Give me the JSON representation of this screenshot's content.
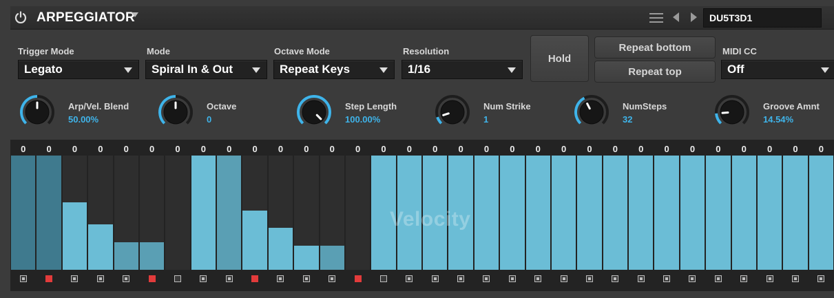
{
  "header": {
    "title": "ARPEGGIATOR",
    "preset_name": "DU5T3D1",
    "icons": [
      "power-icon",
      "hamburger-menu-icon",
      "prev-arrow-icon",
      "next-arrow-icon",
      "chevron-down-icon"
    ]
  },
  "controls": {
    "trigger_mode": {
      "label": "Trigger Mode",
      "value": "Legato"
    },
    "mode": {
      "label": "Mode",
      "value": "Spiral In & Out"
    },
    "octave_mode": {
      "label": "Octave Mode",
      "value": "Repeat Keys"
    },
    "resolution": {
      "label": "Resolution",
      "value": "1/16"
    },
    "hold_label": "Hold",
    "repeat_bottom_label": "Repeat bottom",
    "repeat_top_label": "Repeat top",
    "midi_cc": {
      "label": "MIDI CC",
      "value": "Off"
    }
  },
  "knobs": [
    {
      "key": "arpvel",
      "label": "Arp/Vel. Blend",
      "value": "50.00%",
      "level": 0.5
    },
    {
      "key": "octave",
      "label": "Octave",
      "value": "0",
      "level": 0.5
    },
    {
      "key": "steplen",
      "label": "Step Length",
      "value": "100.00%",
      "level": 1.0
    },
    {
      "key": "numstrike",
      "label": "Num Strike",
      "value": "1",
      "level": 0.1
    },
    {
      "key": "numsteps",
      "label": "NumSteps",
      "value": "32",
      "level": 0.4
    },
    {
      "key": "groove",
      "label": "Groove Amnt",
      "value": "14.54%",
      "level": 0.15
    }
  ],
  "step_editor": {
    "watermark": "Velocity",
    "step_values": [
      "0",
      "0",
      "0",
      "0",
      "0",
      "0",
      "0",
      "0",
      "0",
      "0",
      "0",
      "0",
      "0",
      "0",
      "0",
      "0",
      "0",
      "0",
      "0",
      "0",
      "0",
      "0",
      "0",
      "0",
      "0",
      "0",
      "0",
      "0",
      "0",
      "0",
      "0",
      "0"
    ],
    "velocity_levels": [
      1.0,
      1.0,
      0.59,
      0.4,
      0.24,
      0.24,
      0,
      1.0,
      1.0,
      0.52,
      0.37,
      0.21,
      0.21,
      0,
      1.0,
      1.0,
      1.0,
      1.0,
      1.0,
      1.0,
      1.0,
      1.0,
      1.0,
      1.0,
      1.0,
      1.0,
      1.0,
      1.0,
      1.0,
      1.0,
      1.0,
      1.0
    ],
    "step_gates": [
      "off",
      "on",
      "off",
      "off",
      "off",
      "on",
      "empty",
      "off",
      "off",
      "on",
      "off",
      "off",
      "off",
      "on",
      "empty",
      "off",
      "off",
      "off",
      "off",
      "off",
      "off",
      "off",
      "off",
      "off",
      "off",
      "off",
      "off",
      "off",
      "off",
      "off",
      "off",
      "off"
    ],
    "colors": {
      "bar": "#6bbdd6",
      "bar_dark": "#5a9fb4",
      "bar_darkest": "#3f7a8e",
      "accent": "#3fb4ea",
      "gate_on": "#e23b3b"
    }
  }
}
